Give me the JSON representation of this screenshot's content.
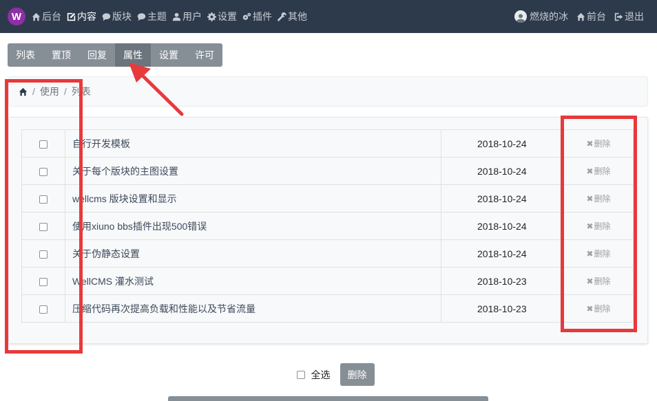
{
  "header": {
    "logo_letter": "W",
    "nav": [
      {
        "label": "后台",
        "icon": "home-icon"
      },
      {
        "label": "内容",
        "icon": "edit-icon",
        "active": true
      },
      {
        "label": "版块",
        "icon": "comment-icon"
      },
      {
        "label": "主题",
        "icon": "comment-icon"
      },
      {
        "label": "用户",
        "icon": "user-icon"
      },
      {
        "label": "设置",
        "icon": "gear-icon"
      },
      {
        "label": "插件",
        "icon": "gears-icon"
      },
      {
        "label": "其他",
        "icon": "wrench-icon"
      }
    ],
    "user_name": "燃烧的冰",
    "front_label": "前台",
    "logout_label": "退出"
  },
  "subtabs": [
    {
      "label": "列表"
    },
    {
      "label": "置顶"
    },
    {
      "label": "回复"
    },
    {
      "label": "属性",
      "active": true
    },
    {
      "label": "设置"
    },
    {
      "label": "许可"
    }
  ],
  "breadcrumb": {
    "items": [
      "使用",
      "列表"
    ],
    "separator": "/"
  },
  "table": {
    "delete_label": "删除",
    "rows": [
      {
        "subject": "自行开发模板",
        "date": "2018-10-24"
      },
      {
        "subject": "关于每个版块的主图设置",
        "date": "2018-10-24"
      },
      {
        "subject": "wellcms 版块设置和显示",
        "date": "2018-10-24"
      },
      {
        "subject": "使用xiuno bbs插件出现500错误",
        "date": "2018-10-24"
      },
      {
        "subject": "关于伪静态设置",
        "date": "2018-10-24"
      },
      {
        "subject": "WellCMS 灌水测试",
        "date": "2018-10-23"
      },
      {
        "subject": "压缩代码再次提高负载和性能以及节省流量",
        "date": "2018-10-23"
      }
    ]
  },
  "footer": {
    "select_all_label": "全选",
    "delete_button_label": "删除"
  },
  "colors": {
    "topbar": "#2d3a4b",
    "annotation": "#e8393b",
    "tab_bg": "#868e96"
  }
}
